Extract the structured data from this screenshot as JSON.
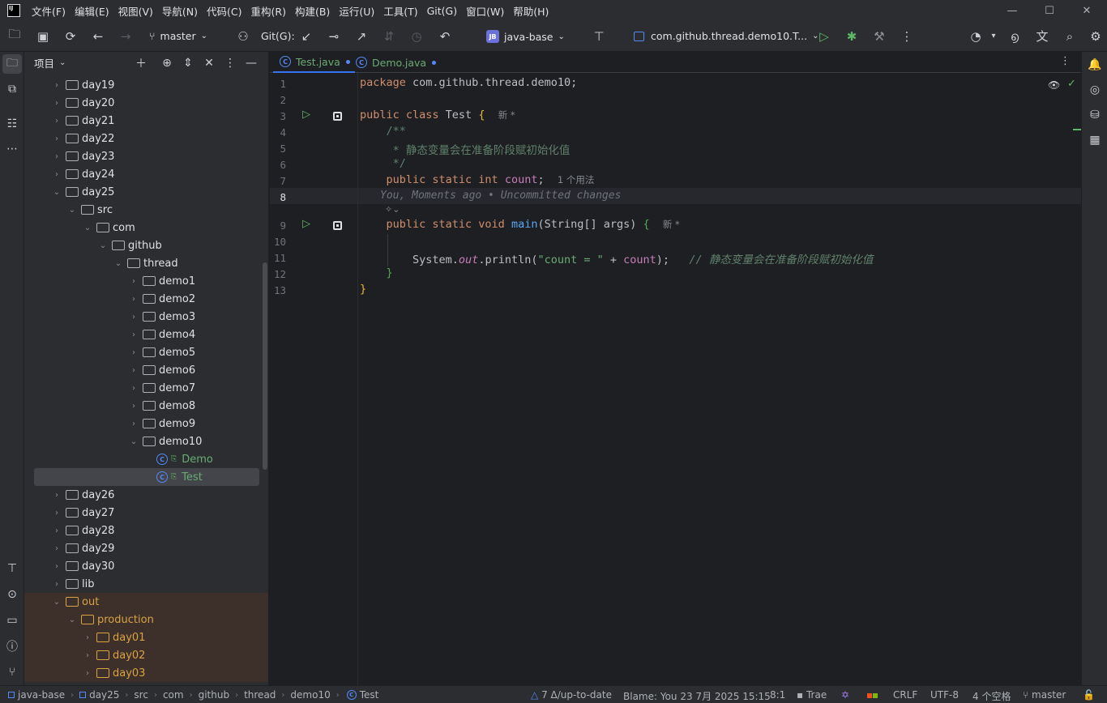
{
  "menu": [
    "文件(F)",
    "编辑(E)",
    "视图(V)",
    "导航(N)",
    "代码(C)",
    "重构(R)",
    "构建(B)",
    "运行(U)",
    "工具(T)",
    "Git(G)",
    "窗口(W)",
    "帮助(H)"
  ],
  "toolbar": {
    "branch": "master",
    "git_label": "Git(G):",
    "project_badge": "JB",
    "project_name": "java-base",
    "run_config": "com.github.thread.demo10.T..."
  },
  "project_panel": {
    "title": "项目",
    "tree": [
      {
        "label": "day19",
        "depth": 1,
        "expanded": false,
        "kind": "folder"
      },
      {
        "label": "day20",
        "depth": 1,
        "expanded": false,
        "kind": "folder"
      },
      {
        "label": "day21",
        "depth": 1,
        "expanded": false,
        "kind": "folder"
      },
      {
        "label": "day22",
        "depth": 1,
        "expanded": false,
        "kind": "folder"
      },
      {
        "label": "day23",
        "depth": 1,
        "expanded": false,
        "kind": "folder"
      },
      {
        "label": "day24",
        "depth": 1,
        "expanded": false,
        "kind": "folder"
      },
      {
        "label": "day25",
        "depth": 1,
        "expanded": true,
        "kind": "folder"
      },
      {
        "label": "src",
        "depth": 2,
        "expanded": true,
        "kind": "srcfolder"
      },
      {
        "label": "com",
        "depth": 3,
        "expanded": true,
        "kind": "folder"
      },
      {
        "label": "github",
        "depth": 4,
        "expanded": true,
        "kind": "folder"
      },
      {
        "label": "thread",
        "depth": 5,
        "expanded": true,
        "kind": "folder"
      },
      {
        "label": "demo1",
        "depth": 6,
        "expanded": false,
        "kind": "folder"
      },
      {
        "label": "demo2",
        "depth": 6,
        "expanded": false,
        "kind": "folder"
      },
      {
        "label": "demo3",
        "depth": 6,
        "expanded": false,
        "kind": "folder"
      },
      {
        "label": "demo4",
        "depth": 6,
        "expanded": false,
        "kind": "folder"
      },
      {
        "label": "demo5",
        "depth": 6,
        "expanded": false,
        "kind": "folder"
      },
      {
        "label": "demo6",
        "depth": 6,
        "expanded": false,
        "kind": "folder"
      },
      {
        "label": "demo7",
        "depth": 6,
        "expanded": false,
        "kind": "folder"
      },
      {
        "label": "demo8",
        "depth": 6,
        "expanded": false,
        "kind": "folder"
      },
      {
        "label": "demo9",
        "depth": 6,
        "expanded": false,
        "kind": "folder"
      },
      {
        "label": "demo10",
        "depth": 6,
        "expanded": true,
        "kind": "folder"
      },
      {
        "label": "Demo",
        "depth": 7,
        "kind": "class"
      },
      {
        "label": "Test",
        "depth": 7,
        "kind": "class",
        "selected": true
      },
      {
        "label": "day26",
        "depth": 1,
        "expanded": false,
        "kind": "folder"
      },
      {
        "label": "day27",
        "depth": 1,
        "expanded": false,
        "kind": "folder"
      },
      {
        "label": "day28",
        "depth": 1,
        "expanded": false,
        "kind": "folder"
      },
      {
        "label": "day29",
        "depth": 1,
        "expanded": false,
        "kind": "folder"
      },
      {
        "label": "day30",
        "depth": 1,
        "expanded": false,
        "kind": "folder"
      },
      {
        "label": "lib",
        "depth": 1,
        "expanded": false,
        "kind": "folder"
      },
      {
        "label": "out",
        "depth": 1,
        "expanded": true,
        "kind": "outfolder"
      },
      {
        "label": "production",
        "depth": 2,
        "expanded": true,
        "kind": "outfolder"
      },
      {
        "label": "day01",
        "depth": 3,
        "expanded": false,
        "kind": "outfolder"
      },
      {
        "label": "day02",
        "depth": 3,
        "expanded": false,
        "kind": "outfolder"
      },
      {
        "label": "day03",
        "depth": 3,
        "expanded": false,
        "kind": "outfolder"
      }
    ]
  },
  "tabs": [
    {
      "label": "Test.java",
      "active": true
    },
    {
      "label": "Demo.java",
      "active": false
    }
  ],
  "editor": {
    "line_numbers": [
      "1",
      "2",
      "3",
      "4",
      "5",
      "6",
      "7",
      "8",
      "9",
      "10",
      "11",
      "12",
      "13"
    ],
    "current_line": "8",
    "code": {
      "l1_kw": "package",
      "l1_rest": " com.github.thread.demo10;",
      "l3_kw": "public class",
      "l3_name": " Test ",
      "l3_brace": "{",
      "l3_hint": "新 *",
      "l4": "    /**",
      "l5": "     * 静态变量会在准备阶段赋初始化值",
      "l6": "     */",
      "l7_kw": "    public static int",
      "l7_field": " count",
      "l7_semi": ";",
      "l7_hint": "1 个用法",
      "blame": "You, Moments ago • Uncommitted changes",
      "l9_kw": "    public static void",
      "l9_fn": " main",
      "l9_args": "(String[] args) ",
      "l9_brace": "{",
      "l9_hint": "新 *",
      "l11_a": "        System.",
      "l11_out": "out",
      "l11_b": ".println(",
      "l11_str": "\"count = \"",
      "l11_c": " + ",
      "l11_field": "count",
      "l11_d": ");",
      "l11_cmt": "   // 静态变量会在准备阶段赋初始化值",
      "l12": "    }",
      "l13": "}"
    }
  },
  "statusbar": {
    "breadcrumbs": [
      "java-base",
      "day25",
      "src",
      "com",
      "github",
      "thread",
      "demo10",
      "Test"
    ],
    "vcs": "7 Δ/up-to-date",
    "blame": "Blame: You 23 7月 2025 15:15",
    "position": "8:1",
    "trae": "Trae",
    "line_sep": "CRLF",
    "encoding": "UTF-8",
    "indent": "4 个空格",
    "branch": "master"
  }
}
